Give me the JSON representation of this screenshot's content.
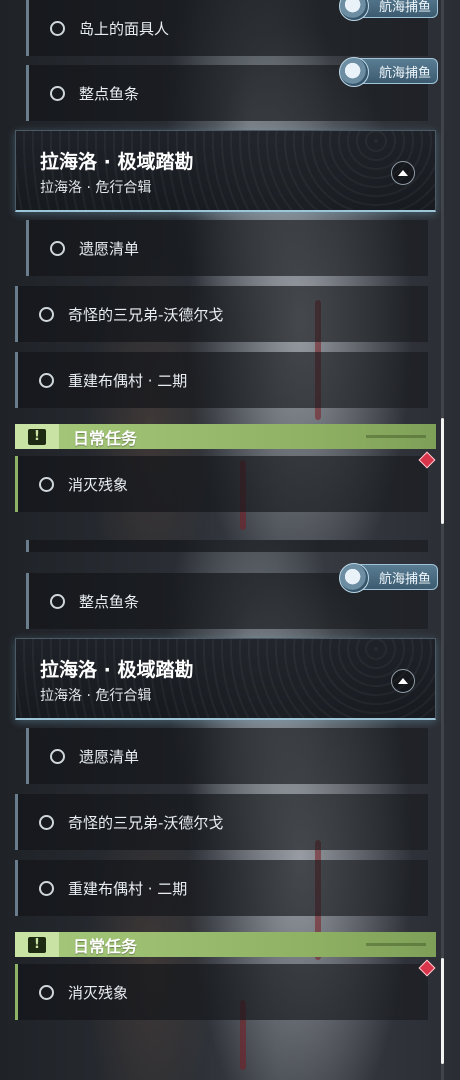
{
  "top": {
    "quests": {
      "mask_man": "岛上的面具人",
      "fish": "整点鱼条",
      "wish_list": "遗愿清单",
      "brothers": "奇怪的三兄弟-沃德尔戈",
      "rebuild": "重建布偶村 · 二期",
      "eliminate": "消灭残象"
    },
    "badge_label": "航海捕鱼",
    "region": {
      "title": "拉海洛 · 极域踏勘",
      "subtitle": "拉海洛 · 危行合辑"
    },
    "daily_label": "日常任务"
  },
  "bottom": {
    "quests": {
      "fish": "整点鱼条",
      "wish_list": "遗愿清单",
      "brothers": "奇怪的三兄弟-沃德尔戈",
      "rebuild": "重建布偶村 · 二期",
      "eliminate": "消灭残象"
    },
    "badge_label": "航海捕鱼",
    "region": {
      "title": "拉海洛 · 极域踏勘",
      "subtitle": "拉海洛 · 危行合辑"
    },
    "daily_label": "日常任务"
  },
  "icons": {
    "quest_status": "circle-icon",
    "collapse": "chevron-up-icon",
    "daily_warning": "exclamation-icon",
    "new_marker": "red-diamond-icon",
    "badge_emblem": "fishing-emblem-icon"
  },
  "colors": {
    "daily_bar": "#a6c97c",
    "card_glow": "#9cc6d8",
    "marker": "#d8344a"
  }
}
